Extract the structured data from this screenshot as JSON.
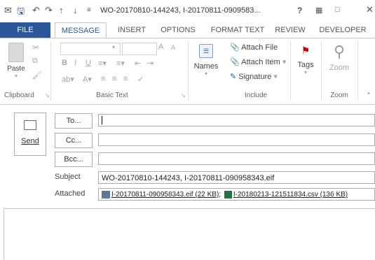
{
  "titlebar": {
    "title": "WO-20170810-144243, I-20170811-0909583...",
    "help": "?",
    "icons": [
      "mail-app-icon",
      "save-icon",
      "undo-icon",
      "redo-icon",
      "up-arrow-icon",
      "down-arrow-icon",
      "customize-toolbar-icon",
      "help-icon",
      "ribbon-display-icon",
      "minimize-icon",
      "close-icon"
    ]
  },
  "tabs": [
    "FILE",
    "MESSAGE",
    "INSERT",
    "OPTIONS",
    "FORMAT TEXT",
    "REVIEW",
    "DEVELOPER"
  ],
  "ribbon": {
    "clipboard": {
      "paste": "Paste",
      "label": "Clipboard"
    },
    "basic_text": {
      "label": "Basic Text",
      "bold": "B",
      "italic": "I",
      "underline": "U",
      "font_grow": "A",
      "font_shrink": "A"
    },
    "names": {
      "label": "Names"
    },
    "include": {
      "attach_file": "Attach File",
      "attach_item": "Attach Item",
      "signature": "Signature",
      "label": "Include"
    },
    "tags": {
      "label": "Tags"
    },
    "zoom": {
      "button": "Zoom",
      "label": "Zoom"
    }
  },
  "form": {
    "send": "Send",
    "to": "To...",
    "cc": "Cc...",
    "bcc": "Bcc...",
    "to_value": "",
    "cc_value": "",
    "bcc_value": "",
    "subject_label": "Subject",
    "subject_value": "WO-20170810-144243, I-20170811-090958343.eif",
    "attached_label": "Attached",
    "attachments": [
      {
        "name": "I-20170811-090958343.eif",
        "size": "(22 KB)"
      },
      {
        "name": "I-20180213-121511834.csv",
        "size": "(136 KB)"
      }
    ],
    "attachment_sep": ";"
  }
}
